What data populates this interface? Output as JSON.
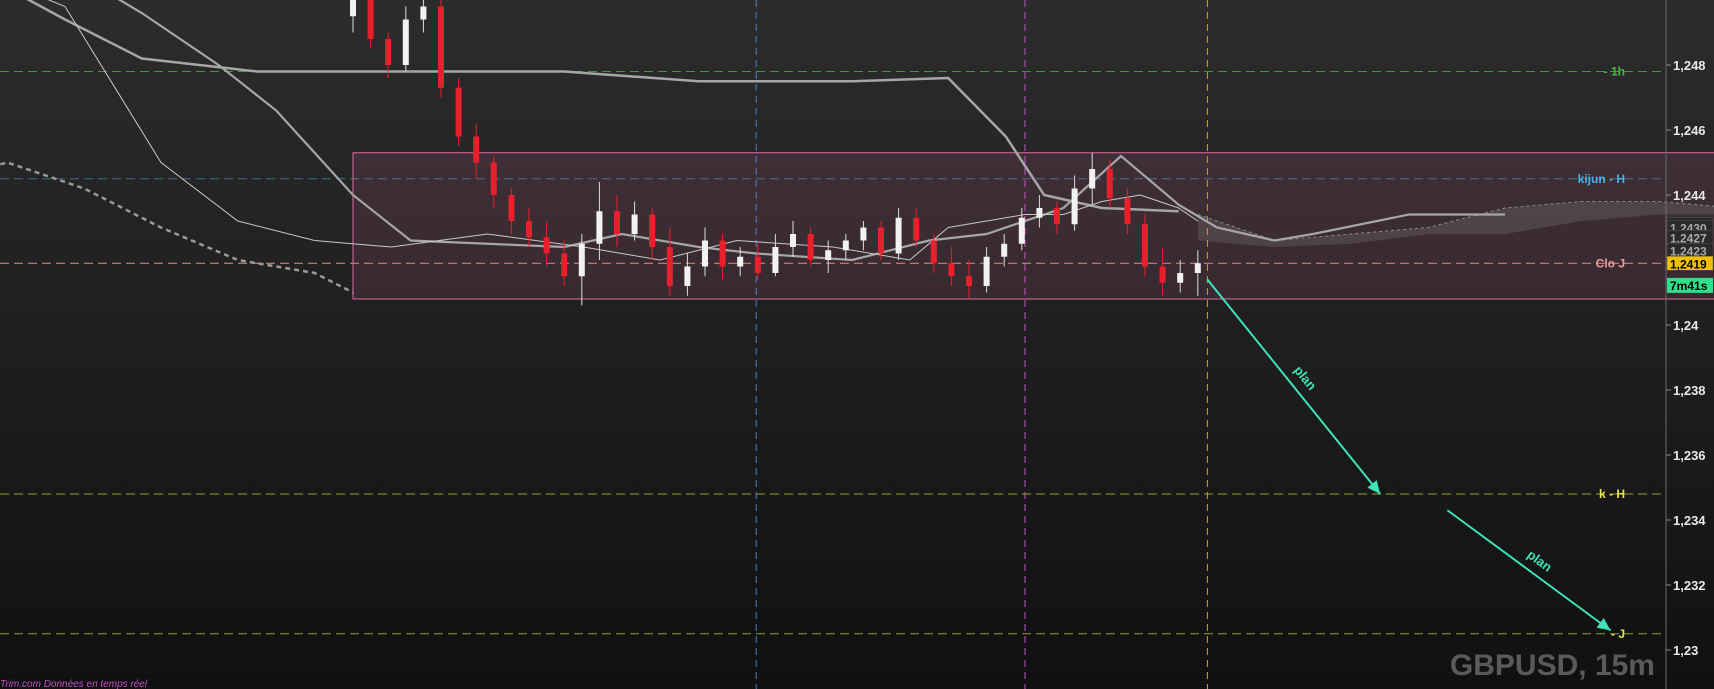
{
  "chart_data": {
    "type": "candlestick",
    "symbol": "GBPUSD, 15m",
    "footer": "Trim.com  Données en temps réel",
    "ylim": [
      1.2288,
      1.25
    ],
    "y_ticks": [
      {
        "value": 1.248,
        "label": "1,248"
      },
      {
        "value": 1.246,
        "label": "1,246"
      },
      {
        "value": 1.244,
        "label": "1,244"
      },
      {
        "value": 1.24,
        "label": "1,24"
      },
      {
        "value": 1.238,
        "label": "1,238"
      },
      {
        "value": 1.236,
        "label": "1,236"
      },
      {
        "value": 1.234,
        "label": "1,234"
      },
      {
        "value": 1.232,
        "label": "1,232"
      },
      {
        "value": 1.23,
        "label": "1,23"
      }
    ],
    "price_boxes": [
      {
        "value": 1.2431,
        "label": "1,2431",
        "color": "#2a2a2a",
        "text_color": "#aaaaaa"
      },
      {
        "value": 1.243,
        "label": "1,2430",
        "color": "#2a2a2a",
        "text_color": "#aaaaaa"
      },
      {
        "value": 1.2427,
        "label": "1,2427",
        "color": "#2a2a2a",
        "text_color": "#aaaaaa"
      },
      {
        "value": 1.2423,
        "label": "1,2423",
        "color": "#2a2a2a",
        "text_color": "#aaaaaa"
      },
      {
        "value": 1.2419,
        "label": "1,2419",
        "color": "#f0c000",
        "text_color": "#000000"
      }
    ],
    "countdown": {
      "value": 1.24145,
      "label": "7m41s",
      "color": "#2fe08a",
      "text_color": "#000000"
    },
    "levels": [
      {
        "name": "- 1h",
        "value": 1.2478,
        "color": "#3a9a3a",
        "label_color": "#3fbf3f"
      },
      {
        "name": "kijun - H",
        "value": 1.2445,
        "color": "#3a6e8a",
        "label_color": "#46b4e6"
      },
      {
        "name": "Clo J",
        "value": 1.2419,
        "color": "#e88a8a",
        "label_color": "#f09a9a"
      },
      {
        "name": "k - H",
        "value": 1.2348,
        "color": "#9a9a2a",
        "label_color": "#e6e646"
      },
      {
        "name": "- J",
        "value": 1.2305,
        "color": "#9a9a2a",
        "label_color": "#e6e646"
      }
    ],
    "vertical_lines": [
      {
        "x": 42,
        "color": "#4a7fc8"
      },
      {
        "x": 70,
        "color": "#c850c8"
      },
      {
        "x": 89,
        "color": "#d8a020"
      }
    ],
    "range_box": {
      "x0": 0,
      "x1": 190,
      "y_low": 1.2408,
      "y_high": 1.2453,
      "color": "#e06aa0"
    },
    "candles": [
      [
        0,
        1.2495,
        1.2502,
        1.249,
        1.25
      ],
      [
        1,
        1.25,
        1.25,
        1.2485,
        1.2488
      ],
      [
        2,
        1.2488,
        1.249,
        1.2476,
        1.248
      ],
      [
        3,
        1.248,
        1.2498,
        1.2478,
        1.2494
      ],
      [
        4,
        1.2494,
        1.25,
        1.249,
        1.2498
      ],
      [
        5,
        1.2498,
        1.25,
        1.247,
        1.2473
      ],
      [
        6,
        1.2473,
        1.2476,
        1.2455,
        1.2458
      ],
      [
        7,
        1.2458,
        1.2462,
        1.2445,
        1.245
      ],
      [
        8,
        1.245,
        1.2452,
        1.2436,
        1.244
      ],
      [
        9,
        1.244,
        1.2442,
        1.2428,
        1.2432
      ],
      [
        10,
        1.2432,
        1.2436,
        1.2424,
        1.2427
      ],
      [
        11,
        1.2427,
        1.2432,
        1.2418,
        1.2422
      ],
      [
        12,
        1.2422,
        1.2426,
        1.2412,
        1.2415
      ],
      [
        13,
        1.2415,
        1.2428,
        1.2406,
        1.2425
      ],
      [
        14,
        1.2425,
        1.2444,
        1.242,
        1.2435
      ],
      [
        15,
        1.2435,
        1.244,
        1.2424,
        1.2428
      ],
      [
        16,
        1.2428,
        1.2438,
        1.2426,
        1.2434
      ],
      [
        17,
        1.2434,
        1.2436,
        1.242,
        1.2424
      ],
      [
        18,
        1.2424,
        1.243,
        1.2409,
        1.2412
      ],
      [
        19,
        1.2412,
        1.2422,
        1.2409,
        1.2418
      ],
      [
        20,
        1.2418,
        1.243,
        1.2415,
        1.2426
      ],
      [
        21,
        1.2426,
        1.2428,
        1.2414,
        1.2418
      ],
      [
        22,
        1.2418,
        1.2424,
        1.2415,
        1.2421
      ],
      [
        23,
        1.2421,
        1.2425,
        1.2414,
        1.2416
      ],
      [
        24,
        1.2416,
        1.2428,
        1.2415,
        1.2424
      ],
      [
        25,
        1.2424,
        1.2432,
        1.2421,
        1.2428
      ],
      [
        26,
        1.2428,
        1.243,
        1.2418,
        1.242
      ],
      [
        27,
        1.242,
        1.2426,
        1.2416,
        1.2423
      ],
      [
        28,
        1.2423,
        1.2428,
        1.242,
        1.2426
      ],
      [
        29,
        1.2426,
        1.2432,
        1.2423,
        1.243
      ],
      [
        30,
        1.243,
        1.2432,
        1.242,
        1.2422
      ],
      [
        31,
        1.2422,
        1.2436,
        1.242,
        1.2433
      ],
      [
        32,
        1.2433,
        1.2436,
        1.2424,
        1.2426
      ],
      [
        33,
        1.2426,
        1.2428,
        1.2416,
        1.2419
      ],
      [
        34,
        1.2419,
        1.2424,
        1.2412,
        1.2415
      ],
      [
        35,
        1.2415,
        1.242,
        1.2408,
        1.2412
      ],
      [
        36,
        1.2412,
        1.2424,
        1.241,
        1.2421
      ],
      [
        37,
        1.2421,
        1.2428,
        1.2418,
        1.2425
      ],
      [
        38,
        1.2425,
        1.2436,
        1.2423,
        1.2433
      ],
      [
        39,
        1.2433,
        1.244,
        1.243,
        1.2436
      ],
      [
        40,
        1.2436,
        1.2438,
        1.2428,
        1.2431
      ],
      [
        41,
        1.2431,
        1.2446,
        1.2429,
        1.2442
      ],
      [
        42,
        1.2442,
        1.2453,
        1.2437,
        1.2448
      ],
      [
        43,
        1.2448,
        1.2451,
        1.2436,
        1.2439
      ],
      [
        44,
        1.2439,
        1.2442,
        1.2428,
        1.2431
      ],
      [
        45,
        1.2431,
        1.2434,
        1.2415,
        1.2418
      ],
      [
        46,
        1.2418,
        1.2424,
        1.2409,
        1.2413
      ],
      [
        47,
        1.2413,
        1.242,
        1.241,
        1.2416
      ],
      [
        48,
        1.2416,
        1.2423,
        1.2409,
        1.2419
      ]
    ],
    "candle_x_start": 0,
    "candle_x_end": 88,
    "tenkan": [
      [
        -40,
        1.251
      ],
      [
        -30,
        1.2498
      ],
      [
        -20,
        1.245
      ],
      [
        -12,
        1.2432
      ],
      [
        -4,
        1.2426
      ],
      [
        4,
        1.2424
      ],
      [
        14,
        1.2428
      ],
      [
        24,
        1.2424
      ],
      [
        32,
        1.242
      ],
      [
        40,
        1.2426
      ],
      [
        50,
        1.2424
      ],
      [
        58,
        1.242
      ],
      [
        62,
        1.243
      ],
      [
        66,
        1.2432
      ],
      [
        70,
        1.2434
      ],
      [
        74,
        1.2434
      ],
      [
        78,
        1.2438
      ],
      [
        82,
        1.244
      ],
      [
        86,
        1.2436
      ],
      [
        88,
        1.2432
      ]
    ],
    "kijun": [
      [
        -30,
        1.251
      ],
      [
        -22,
        1.2496
      ],
      [
        -14,
        1.248
      ],
      [
        -8,
        1.2466
      ],
      [
        0,
        1.244
      ],
      [
        6,
        1.2426
      ],
      [
        14,
        1.2425
      ],
      [
        22,
        1.2424
      ],
      [
        28,
        1.2428
      ],
      [
        36,
        1.2424
      ],
      [
        42,
        1.2422
      ],
      [
        52,
        1.242
      ],
      [
        60,
        1.2426
      ],
      [
        66,
        1.2428
      ],
      [
        74,
        1.2436
      ],
      [
        80,
        1.2452
      ],
      [
        86,
        1.2437
      ],
      [
        90,
        1.243
      ],
      [
        96,
        1.2426
      ],
      [
        100,
        1.2428
      ],
      [
        110,
        1.2434
      ],
      [
        120,
        1.2434
      ]
    ],
    "ssb": [
      [
        -40,
        1.251
      ],
      [
        -30,
        1.2494
      ],
      [
        -22,
        1.2482
      ],
      [
        -10,
        1.2478
      ],
      [
        4,
        1.2478
      ],
      [
        22,
        1.2478
      ],
      [
        36,
        1.2475
      ],
      [
        52,
        1.2475
      ],
      [
        62,
        1.2476
      ],
      [
        68,
        1.2458
      ],
      [
        72,
        1.244
      ],
      [
        78,
        1.2436
      ],
      [
        86,
        1.2435
      ]
    ],
    "chikou": [
      [
        -180,
        1.25
      ],
      [
        -176,
        1.2486
      ],
      [
        -170,
        1.2478
      ],
      [
        -164,
        1.2482
      ],
      [
        -158,
        1.246
      ],
      [
        -152,
        1.2436
      ],
      [
        -146,
        1.2428
      ],
      [
        -140,
        1.242
      ],
      [
        -134,
        1.2412
      ],
      [
        -128,
        1.243
      ],
      [
        -122,
        1.2434
      ],
      [
        -116,
        1.2416
      ],
      [
        -110,
        1.2426
      ],
      [
        -104,
        1.2432
      ],
      [
        -98,
        1.2424
      ],
      [
        -92,
        1.2432
      ],
      [
        -86,
        1.2426
      ],
      [
        -80,
        1.244
      ],
      [
        -74,
        1.243
      ],
      [
        -68,
        1.2426
      ],
      [
        -60,
        1.2436
      ],
      [
        -52,
        1.243
      ],
      [
        -44,
        1.2444
      ],
      [
        -36,
        1.245
      ],
      [
        -28,
        1.2442
      ],
      [
        -20,
        1.243
      ],
      [
        -12,
        1.242
      ],
      [
        -4,
        1.2416
      ],
      [
        0,
        1.241
      ]
    ],
    "cloud_upper": [
      [
        88,
        1.2434
      ],
      [
        96,
        1.2426
      ],
      [
        104,
        1.2428
      ],
      [
        112,
        1.243
      ],
      [
        120,
        1.2436
      ],
      [
        128,
        1.2438
      ],
      [
        136,
        1.2438
      ],
      [
        144,
        1.2436
      ],
      [
        150,
        1.2432
      ]
    ],
    "cloud_lower": [
      [
        88,
        1.2426
      ],
      [
        96,
        1.2424
      ],
      [
        104,
        1.2425
      ],
      [
        112,
        1.2428
      ],
      [
        120,
        1.2428
      ],
      [
        128,
        1.2432
      ],
      [
        136,
        1.2434
      ],
      [
        144,
        1.2434
      ],
      [
        150,
        1.2432
      ]
    ],
    "annotations": [
      {
        "text": "plan",
        "from": [
          89,
          1.2414
        ],
        "to": [
          107,
          1.2348
        ]
      },
      {
        "text": "plan",
        "from": [
          114,
          1.2343
        ],
        "to": [
          131,
          1.2306
        ]
      }
    ]
  }
}
